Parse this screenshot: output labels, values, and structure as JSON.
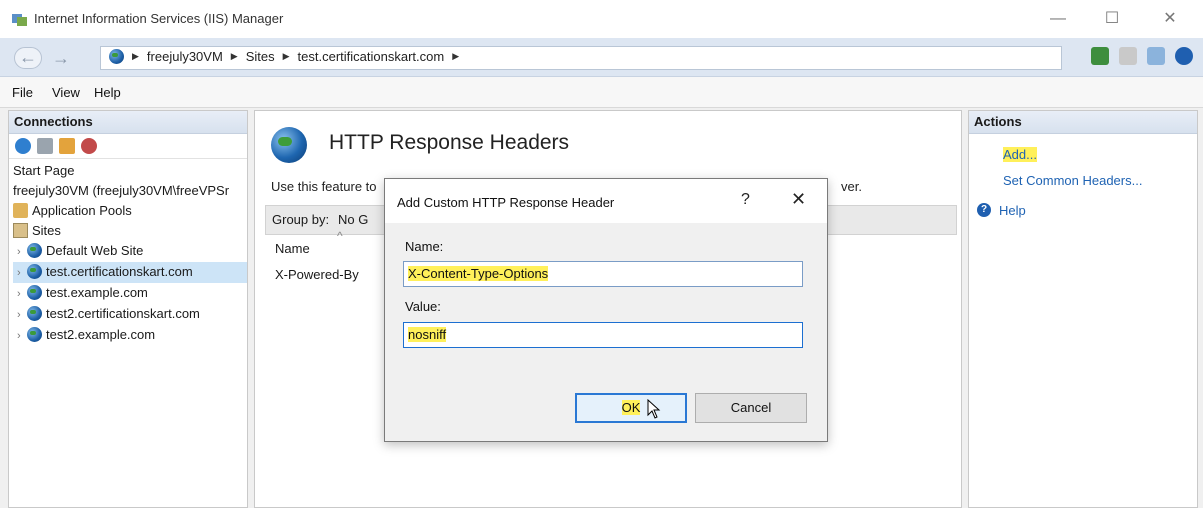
{
  "window": {
    "title": "Internet Information Services (IIS) Manager"
  },
  "address": {
    "crumbs": [
      "freejuly30VM",
      "Sites",
      "test.certificationskart.com"
    ]
  },
  "menu": {
    "items": [
      "File",
      "View",
      "Help"
    ]
  },
  "connections": {
    "header": "Connections",
    "tree": {
      "start_page": "Start Page",
      "server": "freejuly30VM (freejuly30VM\\freeVPSr",
      "app_pools": "Application Pools",
      "sites": "Sites",
      "site_items": [
        "Default Web Site",
        "test.certificationskart.com",
        "test.example.com",
        "test2.certificationskart.com",
        "test2.example.com"
      ]
    }
  },
  "feature": {
    "title": "HTTP Response Headers",
    "description_start": "Use this feature to",
    "description_end": "ver.",
    "group_by_label": "Group by:",
    "group_by_value": "No G",
    "column_name": "Name",
    "rows": [
      "X-Powered-By"
    ]
  },
  "actions": {
    "header": "Actions",
    "add": "Add...",
    "set_common": "Set Common Headers...",
    "help": "Help"
  },
  "dialog": {
    "title": "Add Custom HTTP Response Header",
    "help_glyph": "?",
    "close_glyph": "✕",
    "name_label": "Name:",
    "name_value": "X-Content-Type-Options",
    "value_label": "Value:",
    "value_value": "nosniff",
    "ok_label": "OK",
    "cancel_label": "Cancel"
  },
  "colors": {
    "highlight": "#fff05a",
    "link": "#1f63b3",
    "selection": "#cde4f7"
  }
}
